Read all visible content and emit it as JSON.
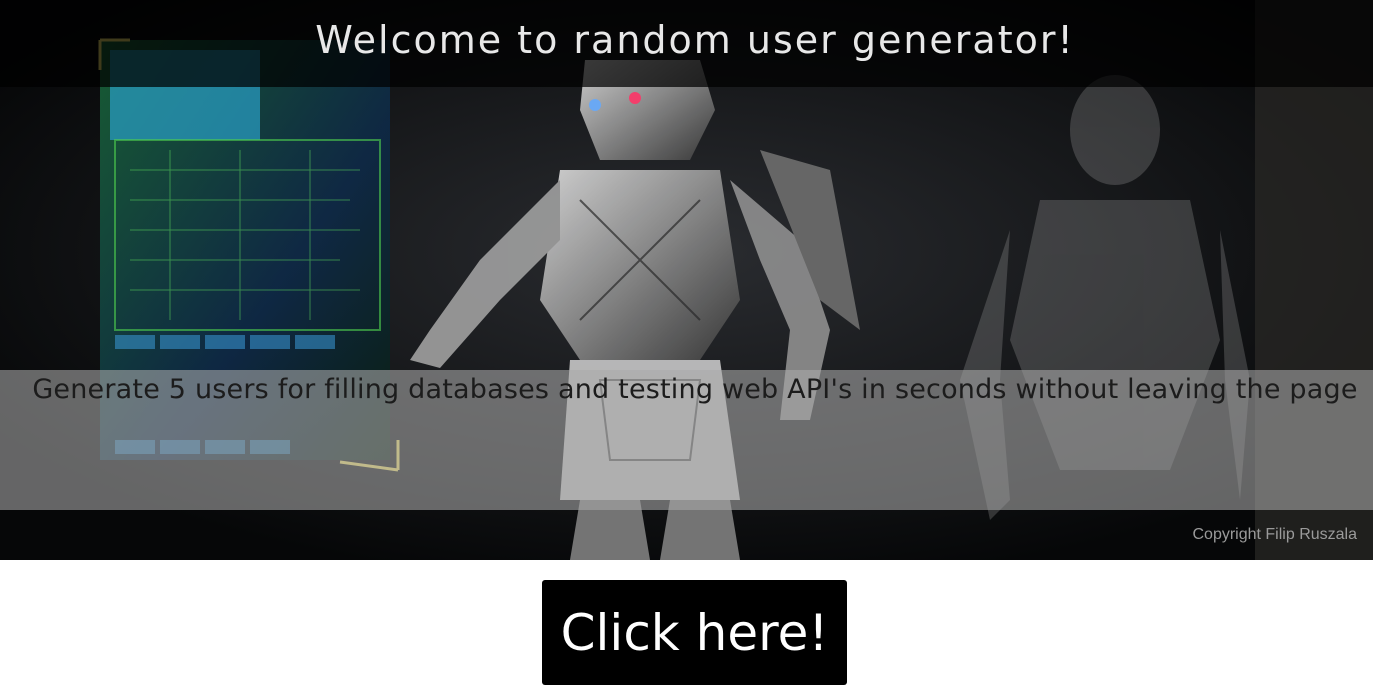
{
  "hero": {
    "title": "Welcome to random user generator!",
    "subtitle": "Generate 5 users for filling databases and testing web API's in seconds without leaving the page",
    "copyright": "Copyright Filip Ruszala"
  },
  "cta": {
    "label": "Click here!"
  },
  "colors": {
    "title_text": "#e8e8e8",
    "subtitle_text": "#1c1c1c",
    "button_bg": "#000000",
    "button_text": "#ffffff"
  }
}
